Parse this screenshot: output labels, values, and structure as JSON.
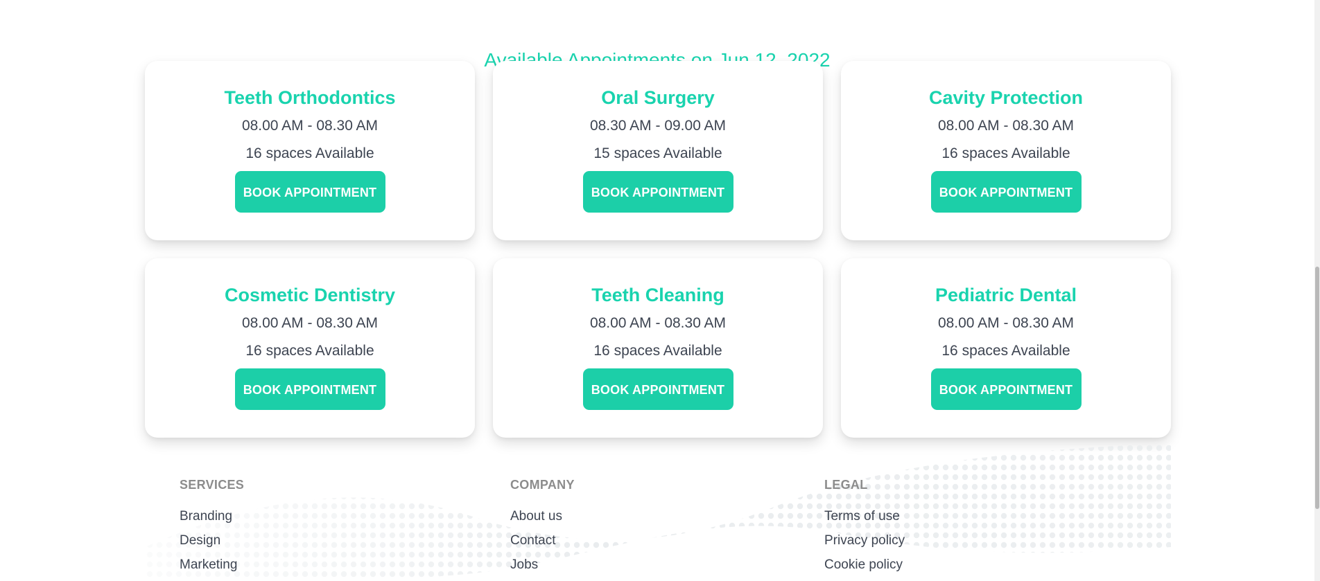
{
  "section": {
    "heading": "Available Appointments on Jun 12, 2022"
  },
  "appointments": [
    {
      "title": "Teeth Orthodontics",
      "time": "08.00 AM - 08.30 AM",
      "spaces": "16 spaces Available",
      "button": "BOOK APPOINTMENT"
    },
    {
      "title": "Oral Surgery",
      "time": "08.30 AM - 09.00 AM",
      "spaces": "15 spaces Available",
      "button": "BOOK APPOINTMENT"
    },
    {
      "title": "Cavity Protection",
      "time": "08.00 AM - 08.30 AM",
      "spaces": "16 spaces Available",
      "button": "BOOK APPOINTMENT"
    },
    {
      "title": "Cosmetic Dentistry",
      "time": "08.00 AM - 08.30 AM",
      "spaces": "16 spaces Available",
      "button": "BOOK APPOINTMENT"
    },
    {
      "title": "Teeth Cleaning",
      "time": "08.00 AM - 08.30 AM",
      "spaces": "16 spaces Available",
      "button": "BOOK APPOINTMENT"
    },
    {
      "title": "Pediatric Dental",
      "time": "08.00 AM - 08.30 AM",
      "spaces": "16 spaces Available",
      "button": "BOOK APPOINTMENT"
    }
  ],
  "footer": {
    "services": {
      "title": "SERVICES",
      "links": [
        "Branding",
        "Design",
        "Marketing"
      ]
    },
    "company": {
      "title": "COMPANY",
      "links": [
        "About us",
        "Contact",
        "Jobs"
      ]
    },
    "legal": {
      "title": "LEGAL",
      "links": [
        "Terms of use",
        "Privacy policy",
        "Cookie policy"
      ]
    }
  },
  "colors": {
    "accent": "#19d3ae",
    "text": "#3d4451",
    "footer_heading": "#8c8c8c"
  }
}
